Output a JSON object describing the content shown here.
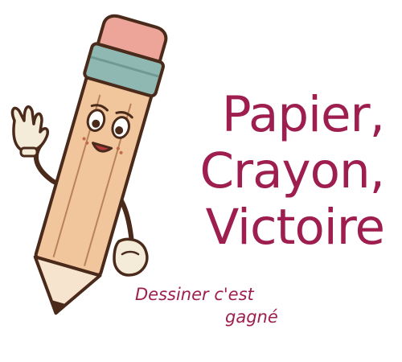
{
  "brand": {
    "title_lines": [
      "Papier,",
      "Crayon,",
      "Victoire"
    ],
    "tagline_lines": [
      "Dessiner c'est",
      "gagné"
    ],
    "title_color": "#9e1f4f",
    "tagline_color": "#9e1f4f"
  },
  "mascot": {
    "icon": "pencil-character-icon",
    "pencil_body_color": "#f2c69c",
    "eraser_color": "#eda59a",
    "ferrule_color": "#8fb8b2",
    "glove_color": "#f4ecd8",
    "outline_color": "#4a2a1a"
  }
}
